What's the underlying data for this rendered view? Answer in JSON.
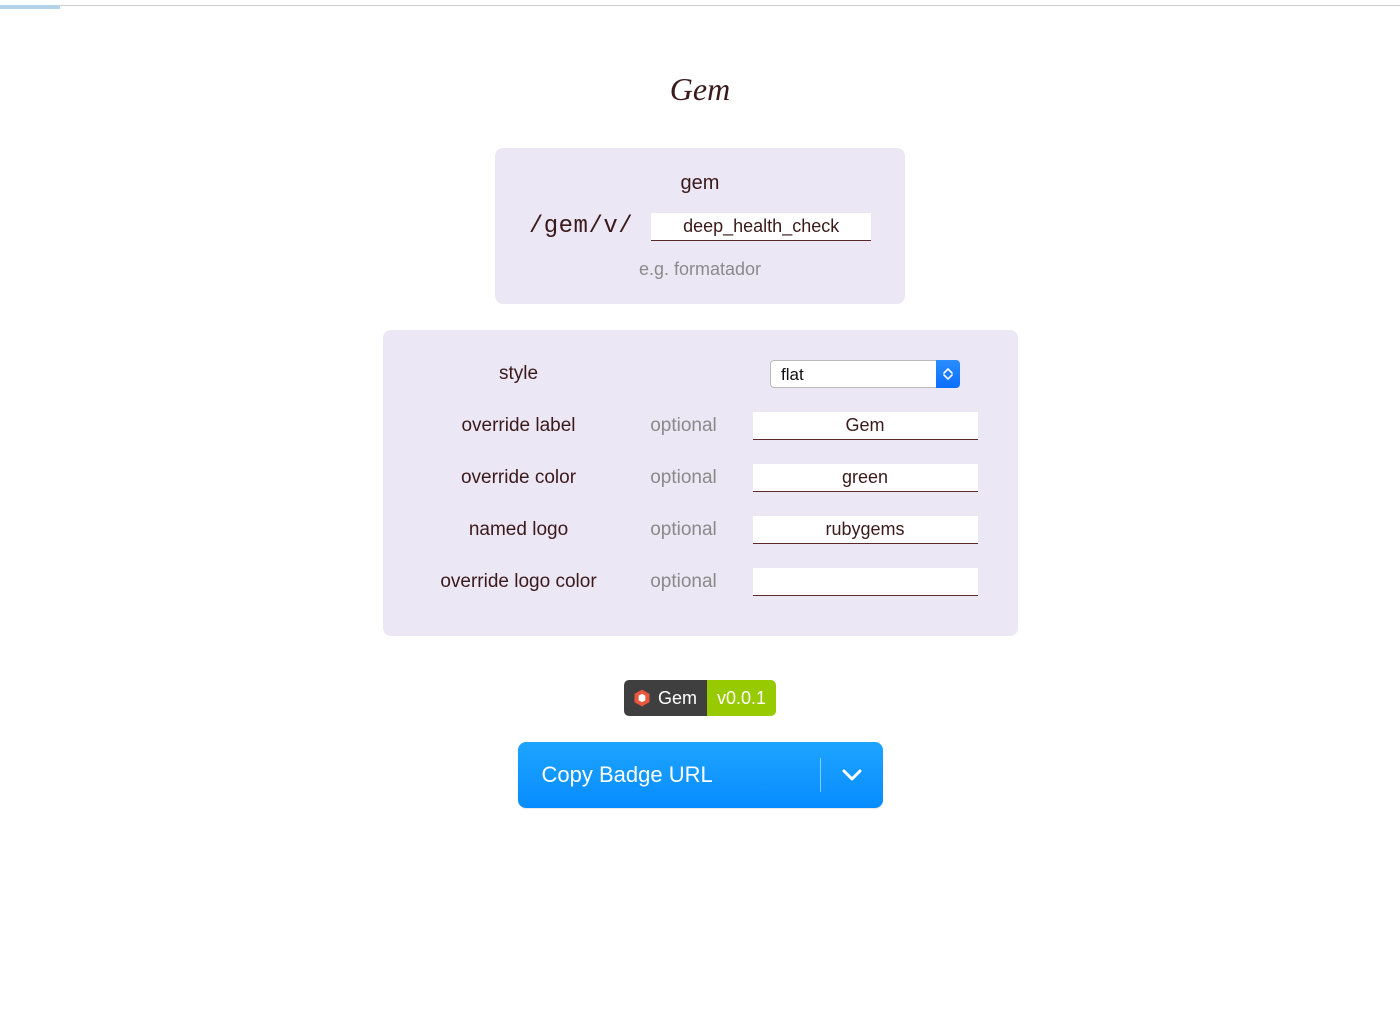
{
  "title": "Gem",
  "gem_panel": {
    "caption": "gem",
    "prefix": "/gem/v/",
    "value": "deep_health_check",
    "example": "e.g. formatador"
  },
  "options": {
    "style": {
      "label": "style",
      "hint": "",
      "value": "flat"
    },
    "override_label": {
      "label": "override label",
      "hint": "optional",
      "value": "Gem"
    },
    "override_color": {
      "label": "override color",
      "hint": "optional",
      "value": "green"
    },
    "named_logo": {
      "label": "named logo",
      "hint": "optional",
      "value": "rubygems"
    },
    "override_logo_color": {
      "label": "override logo color",
      "hint": "optional",
      "value": ""
    }
  },
  "badge": {
    "label": "Gem",
    "value": "v0.0.1",
    "icon": "rubygems-icon",
    "left_bg": "#3f3f3f",
    "right_bg": "#97ca00"
  },
  "copy_button": {
    "label": "Copy Badge URL"
  }
}
